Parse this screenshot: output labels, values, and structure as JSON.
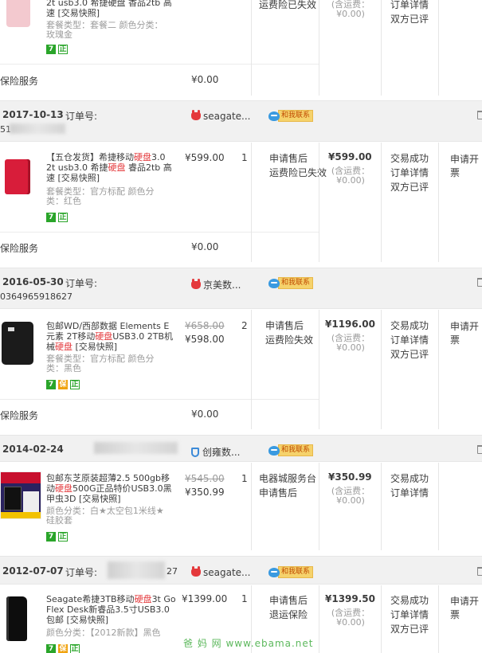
{
  "orders_top": {
    "title_tail": "2t usb3.0 希捷硬盘 香品2tb 高",
    "title_tail2": "速 [交易快照]",
    "sku1": "套餐类型：套餐二 颜色分类：",
    "sku2": "玫瑰金",
    "service1": "运费险已失效",
    "ship1": "(含运费：",
    "ship2": "¥0.00)",
    "status1": "订单详情",
    "status2": "双方已评",
    "insurance": "保险服务",
    "ins_price": "¥0.00"
  },
  "order_label": "订单号:",
  "orders": [
    {
      "date": "2017-10-13",
      "order_no_partial": "51",
      "shop": "seagate...",
      "contact": "和我联系",
      "title_a": "【五仓发货】希捷移动",
      "title_hl": "硬盘",
      "title_b": "3.0",
      "title_c": "2t usb3.0 希捷",
      "title_hl2": "硬盘",
      "title_d": " 睿品2tb 高",
      "title_e": "速 [交易快照]",
      "sku1": "套餐类型：官方标配 颜色分",
      "sku2": "类：红色",
      "price": "¥599.00",
      "qty": "1",
      "svc1": "申请售后",
      "svc2": "运费险已失效",
      "total": "¥599.00",
      "ship1": "(含运费：",
      "ship2": "¥0.00)",
      "st1": "交易成功",
      "st2": "订单详情",
      "st3": "双方已评",
      "action": "申请开票",
      "insurance": "保险服务",
      "ins_price": "¥0.00"
    },
    {
      "date": "2016-05-30",
      "order_no_partial": "0364965918627",
      "shop": "京美数...",
      "contact": "和我联系",
      "title_a": "包邮WD/西部数据 Elements E",
      "title_b": "元素 2T移动",
      "title_hl": "硬盘",
      "title_c": "USB3.0 2TB机",
      "title_d": "械",
      "title_hl2": "硬盘",
      "title_e": " [交易快照]",
      "sku1": "套餐类型：官方标配 颜色分",
      "sku2": "类：黑色",
      "orig_price": "¥658.00",
      "price": "¥598.00",
      "qty": "2",
      "svc1": "申请售后",
      "svc2": "运费险失效",
      "total": "¥1196.00",
      "ship1": "(含运费：",
      "ship2": "¥0.00)",
      "st1": "交易成功",
      "st2": "订单详情",
      "st3": "双方已评",
      "action": "申请开票",
      "insurance": "保险服务",
      "ins_price": "¥0.00"
    },
    {
      "date": "2014-02-24",
      "shop": "创雍数...",
      "contact": "和我联系",
      "title_a": "包邮东芝原装超薄2.5 500gb移",
      "title_b": "动",
      "title_hl": "硬盘",
      "title_c": "500G正品特价USB3.0黑",
      "title_d": "甲虫3D [交易快照]",
      "sku1": "颜色分类：白★太空包1米线★",
      "sku2": "硅胶套",
      "orig_price": "¥545.00",
      "price": "¥350.99",
      "qty": "1",
      "svc1": "电器城服务台",
      "svc2": "申请售后",
      "total": "¥350.99",
      "ship1": "(含运费：",
      "ship2": "¥0.00)",
      "st1": "交易成功",
      "st2": "订单详情"
    },
    {
      "date": "2012-07-07",
      "order_no_tail": "27",
      "shop": "seagate...",
      "contact": "和我联系",
      "title_a": "Seagate希捷3TB移动",
      "title_hl": "硬盘",
      "title_b": "3t Go",
      "title_c": "Flex Desk新睿品3.5寸USB3.0",
      "title_d": "包邮 [交易快照]",
      "sku1": "颜色分类：【2012新款】黑色",
      "price": "¥1399.00",
      "qty": "1",
      "svc1": "申请售后",
      "svc2": "退运保险",
      "total": "¥1399.50",
      "ship1": "(含运费：",
      "ship2": "¥0.00)",
      "st1": "交易成功",
      "st2": "订单详情",
      "st3": "双方已评",
      "action": "申请开票"
    }
  ],
  "badges": {
    "seven": "7",
    "zheng": "正",
    "guarantee": "保"
  },
  "watermark": "爸 妈 网  www.ebama.net",
  "colors": {
    "highlight": "#e4393c",
    "badge_green": "#2aa52a",
    "header_bg": "#f1f1f1"
  }
}
